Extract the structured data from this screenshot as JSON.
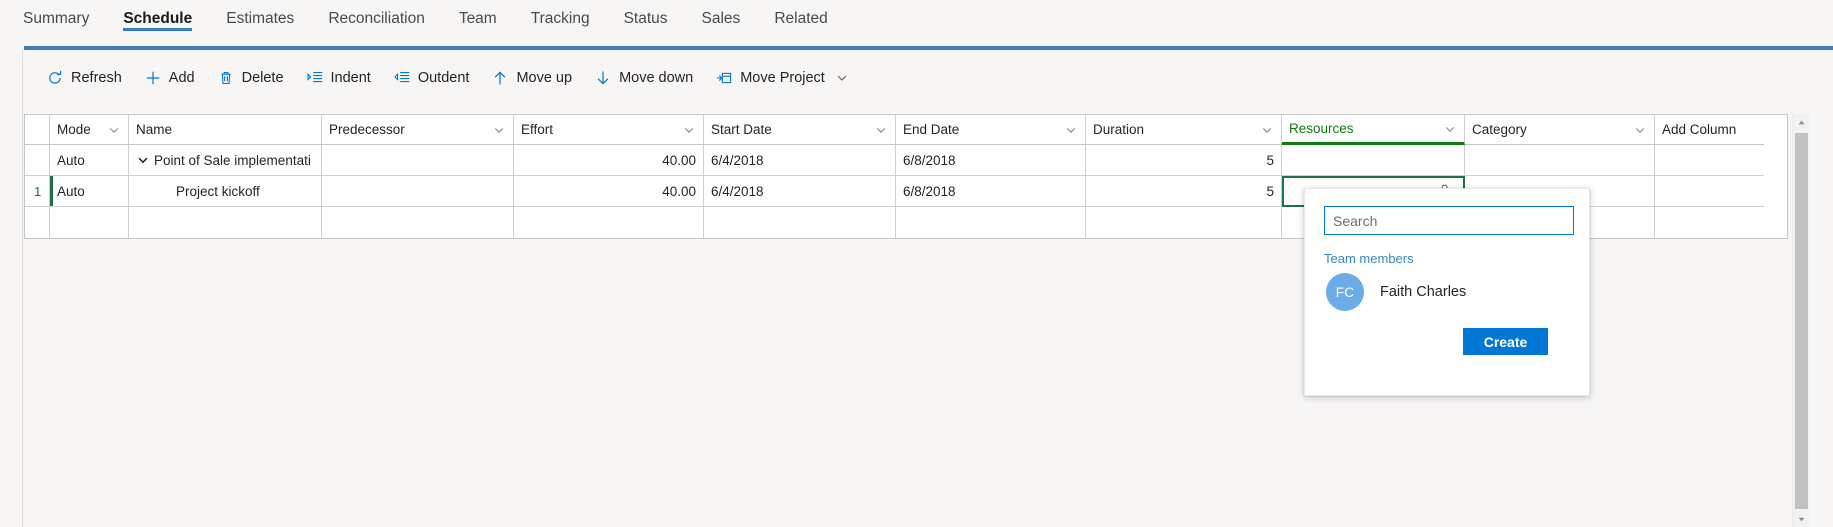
{
  "tabs": [
    {
      "label": "Summary",
      "active": false
    },
    {
      "label": "Schedule",
      "active": true
    },
    {
      "label": "Estimates",
      "active": false
    },
    {
      "label": "Reconciliation",
      "active": false
    },
    {
      "label": "Team",
      "active": false
    },
    {
      "label": "Tracking",
      "active": false
    },
    {
      "label": "Status",
      "active": false
    },
    {
      "label": "Sales",
      "active": false
    },
    {
      "label": "Related",
      "active": false
    }
  ],
  "toolbar": {
    "refresh": "Refresh",
    "add": "Add",
    "delete": "Delete",
    "indent": "Indent",
    "outdent": "Outdent",
    "move_up": "Move up",
    "move_down": "Move down",
    "move_project": "Move Project"
  },
  "grid": {
    "headers": {
      "rownum": "",
      "mode": "Mode",
      "name": "Name",
      "predecessor": "Predecessor",
      "effort": "Effort",
      "start_date": "Start Date",
      "end_date": "End Date",
      "duration": "Duration",
      "resources": "Resources",
      "category": "Category",
      "add_column": "Add Column"
    },
    "accent_header": "resources",
    "rows": [
      {
        "rownum": "",
        "mode": "Auto",
        "name": "Point of Sale implementati",
        "predecessor": "",
        "effort": "40.00",
        "start_date": "6/4/2018",
        "end_date": "6/8/2018",
        "duration": "5",
        "resources": "",
        "category": "",
        "add_column": ""
      },
      {
        "rownum": "1",
        "mode": "Auto",
        "name": "Project kickoff",
        "predecessor": "",
        "effort": "40.00",
        "start_date": "6/4/2018",
        "end_date": "6/8/2018",
        "duration": "5",
        "resources": "",
        "category": "",
        "add_column": ""
      },
      {
        "rownum": "",
        "mode": "",
        "name": "",
        "predecessor": "",
        "effort": "",
        "start_date": "",
        "end_date": "",
        "duration": "",
        "resources": "",
        "category": "",
        "add_column": ""
      }
    ]
  },
  "resource_flyout": {
    "search_value": "",
    "search_placeholder": "Search",
    "section_label": "Team members",
    "person_initials": "FC",
    "person_name": "Faith Charles",
    "create_label": "Create"
  },
  "colors": {
    "accent_blue": "#0078d4",
    "tab_underline": "#3a7cbe",
    "selection_green": "#1e7145",
    "header_accent_green": "#107c10",
    "avatar_blue": "#6babe8"
  }
}
